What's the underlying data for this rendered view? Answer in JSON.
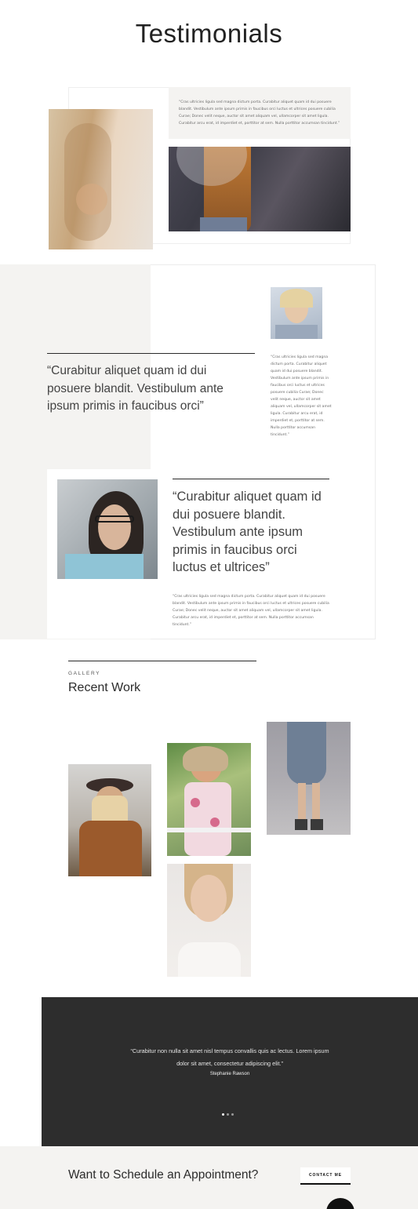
{
  "header": {
    "title": "Testimonials"
  },
  "testimonial1": {
    "text": "“Cras ultricies ligula sed magna dictum porta. Curabitur aliquet quam id dui posuere blandit. Vestibulum ante ipsum primis in faucibus orci luctus et ultrices posuere cubilia Curae; Donec velit neque, auctor sit amet aliquam vel, ullamcorper sit amet ligula. Curabitur arcu erat, id imperdiet et, porttitor at sem. Nulla porttitor accumsan tincidunt.”"
  },
  "testimonial2": {
    "quote": "“Curabitur aliquet quam id dui posuere blandit. Vestibulum ante ipsum primis in faucibus orci”",
    "text": "“Cras ultricies ligula sed magna dictum porta. Curabitur aliquet quam id dui posuere blandit. Vestibulum ante ipsum primis in faucibus orci luctus et ultrices posuere cubilia Curae; Donec velit neque, auctor sit amet aliquam vel, ullamcorper sit amet ligula. Curabitur arcu erat, id imperdiet et, porttitor at sem. Nulla porttitor accumsan tincidunt.”"
  },
  "testimonial3": {
    "quote": "“Curabitur aliquet quam id dui posuere blandit. Vestibulum ante ipsum primis in faucibus orci luctus et ultrices”",
    "text": "“Cras ultricies ligula sed magna dictum porta. Curabitur aliquet quam id dui posuere blandit. Vestibulum ante ipsum primis in faucibus orci luctus et ultrices posuere cubilia Curae; Donec velit neque, auctor sit amet aliquam vel, ullamcorper sit amet ligula. Curabitur arcu erat, id imperdiet et, porttitor at sem. Nulla porttitor accumsan tincidunt.”"
  },
  "gallery": {
    "eyebrow": "GALLERY",
    "title": "Recent Work"
  },
  "slider": {
    "quote": "“Curabitur non nulla sit amet nisl tempus convallis quis ac lectus. Lorem ipsum dolor sit amet, consectetur adipiscing elit.”",
    "author": "Stephanie Rawson"
  },
  "cta": {
    "text": "Want to Schedule an Appointment?",
    "button": "CONTACT ME"
  },
  "colors": {
    "dark_band": "#2d2d2d",
    "light_gray": "#f4f3f1",
    "text": "#2b2b2b"
  }
}
